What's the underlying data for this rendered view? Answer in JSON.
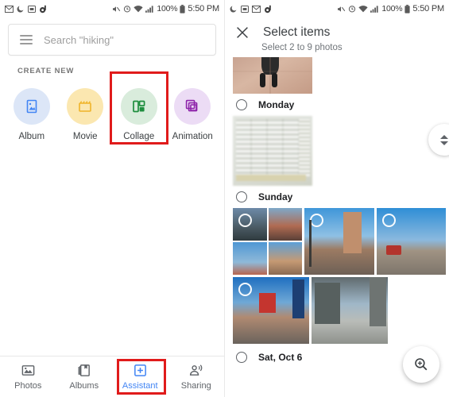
{
  "left_screen": {
    "statusbar": {
      "icons_left": [
        "mail-icon",
        "do-not-disturb-icon",
        "message-icon",
        "app-logo-icon"
      ],
      "icons_right": [
        "volume-off-icon",
        "alarm-icon",
        "wifi-icon",
        "signal-icon"
      ],
      "battery_percent": "100%",
      "battery_icon": "battery-full-icon",
      "time": "5:50 PM"
    },
    "search": {
      "menu_icon": "hamburger-menu-icon",
      "placeholder": "Search \"hiking\""
    },
    "create_new": {
      "section_label": "CREATE NEW",
      "items": [
        {
          "label": "Album",
          "icon": "album-icon",
          "circle_color": "#dce6f7",
          "icon_color": "#4285f4"
        },
        {
          "label": "Movie",
          "icon": "movie-icon",
          "circle_color": "#fbe7b0",
          "icon_color": "#f0b429"
        },
        {
          "label": "Collage",
          "icon": "collage-icon",
          "circle_color": "#d9ecdc",
          "icon_color": "#1e8e3e"
        },
        {
          "label": "Animation",
          "icon": "animation-icon",
          "circle_color": "#ecdcf5",
          "icon_color": "#8e24aa"
        }
      ]
    },
    "bottom_nav": {
      "items": [
        {
          "label": "Photos",
          "icon": "photos-icon",
          "active": false
        },
        {
          "label": "Albums",
          "icon": "albums-icon",
          "active": false
        },
        {
          "label": "Assistant",
          "icon": "assistant-icon",
          "active": true
        },
        {
          "label": "Sharing",
          "icon": "sharing-icon",
          "active": false
        }
      ],
      "active_color": "#4285f4"
    },
    "annotations": [
      {
        "name": "collage-highlight",
        "color": "#e01b1b"
      },
      {
        "name": "assistant-highlight",
        "color": "#e01b1b"
      }
    ]
  },
  "right_screen": {
    "statusbar": {
      "icons_left": [
        "do-not-disturb-icon",
        "message-icon",
        "mail-icon",
        "app-logo-icon"
      ],
      "icons_right": [
        "volume-off-icon",
        "alarm-icon",
        "wifi-icon",
        "signal-icon"
      ],
      "battery_percent": "100%",
      "battery_icon": "battery-full-icon",
      "time": "5:50 PM"
    },
    "header": {
      "close_icon": "close-icon",
      "title": "Select items",
      "subtitle": "Select 2 to 9 photos"
    },
    "groups": [
      {
        "date_label": "Monday",
        "selected": false
      },
      {
        "date_label": "Sunday",
        "selected": false
      },
      {
        "date_label": "Sat, Oct 6",
        "selected": false
      }
    ],
    "scroll_thumb": {
      "icon": "scroll-handle-icon"
    },
    "fab": {
      "icon": "zoom-in-icon"
    }
  }
}
